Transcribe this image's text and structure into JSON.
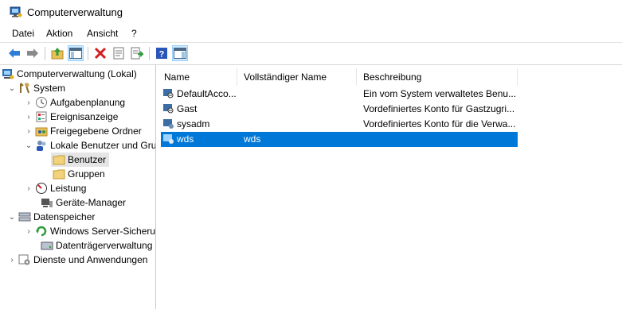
{
  "window": {
    "title": "Computerverwaltung"
  },
  "menu": [
    "Datei",
    "Aktion",
    "Ansicht",
    "?"
  ],
  "toolbar": [
    "back-icon",
    "forward-icon",
    "up-folder-icon",
    "show-hide-tree-icon",
    "delete-icon",
    "properties-icon",
    "export-list-icon",
    "help-icon",
    "show-hide-action-pane-icon"
  ],
  "tree": [
    {
      "label": "Computerverwaltung (Lokal)",
      "icon": "computer-management-icon"
    },
    {
      "label": "System",
      "icon": "system-tools-icon"
    },
    {
      "label": "Aufgabenplanung",
      "icon": "task-scheduler-icon"
    },
    {
      "label": "Ereignisanzeige",
      "icon": "event-viewer-icon"
    },
    {
      "label": "Freigegebene Ordner",
      "icon": "shared-folders-icon"
    },
    {
      "label": "Lokale Benutzer und Gruppen",
      "icon": "local-users-groups-icon"
    },
    {
      "label": "Benutzer",
      "icon": "folder-icon"
    },
    {
      "label": "Gruppen",
      "icon": "folder-icon"
    },
    {
      "label": "Leistung",
      "icon": "performance-icon"
    },
    {
      "label": "Geräte-Manager",
      "icon": "device-manager-icon"
    },
    {
      "label": "Datenspeicher",
      "icon": "storage-icon"
    },
    {
      "label": "Windows Server-Sicherung",
      "icon": "backup-icon"
    },
    {
      "label": "Datenträgerverwaltung",
      "icon": "disk-management-icon"
    },
    {
      "label": "Dienste und Anwendungen",
      "icon": "services-applications-icon"
    }
  ],
  "list": {
    "columns": [
      "Name",
      "Vollständiger Name",
      "Beschreibung"
    ],
    "rows": [
      {
        "name": "DefaultAcco...",
        "fullname": "",
        "desc": "Ein vom System verwaltetes Benu..."
      },
      {
        "name": "Gast",
        "fullname": "",
        "desc": "Vordefiniertes Konto für Gastzugri..."
      },
      {
        "name": "sysadm",
        "fullname": "",
        "desc": "Vordefiniertes Konto für die Verwa..."
      },
      {
        "name": "wds",
        "fullname": "wds",
        "desc": ""
      }
    ]
  },
  "colors": {
    "selection": "#0078d7",
    "tree_selection": "#e5e5e5"
  }
}
